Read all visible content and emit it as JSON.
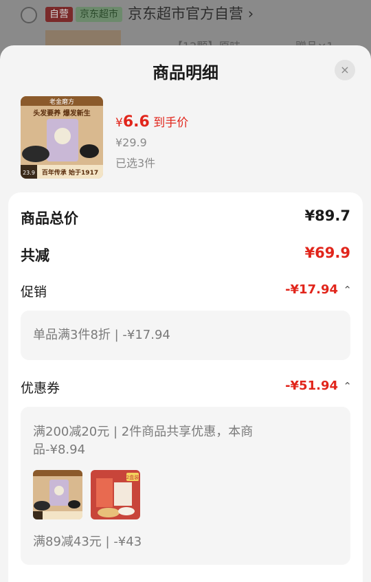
{
  "background": {
    "self_badge": "自营",
    "jd_badge": "京东超市",
    "shop_name": "京东超市官方自营",
    "shop_chevron": "›",
    "sub_text": "【12颗】原味",
    "gift_text": "赠品×1"
  },
  "sheet": {
    "title": "商品明细",
    "close_icon": "×"
  },
  "product": {
    "img_top_text": "老金磨方",
    "img_slogan": "头发要养 爆发新生",
    "img_price_tag": "23.9",
    "img_bottom_text": "百年传承 始于1917",
    "currency": "¥",
    "final_price": "6.6",
    "final_label": "到手价",
    "original_price": "¥29.9",
    "selected_count": "已选3件"
  },
  "summary": {
    "total_label": "商品总价",
    "total_value": "¥89.7",
    "reduce_label": "共减",
    "reduce_value": "¥69.9"
  },
  "promotion": {
    "label": "促销",
    "value": "-¥17.94",
    "chevron": "⌃",
    "detail": "单品满3件8折 | -¥17.94"
  },
  "coupon": {
    "label": "优惠券",
    "value": "-¥51.94",
    "chevron": "⌃",
    "detail_line1": "满200减20元 | 2件商品共享优惠，本商",
    "detail_line2": "品-¥8.94",
    "thumb2_badge": "2盒装",
    "detail_bottom": "满89减43元 | -¥43"
  },
  "colors": {
    "accent_red": "#e1251b",
    "muted_gray": "#8a8a8a"
  }
}
